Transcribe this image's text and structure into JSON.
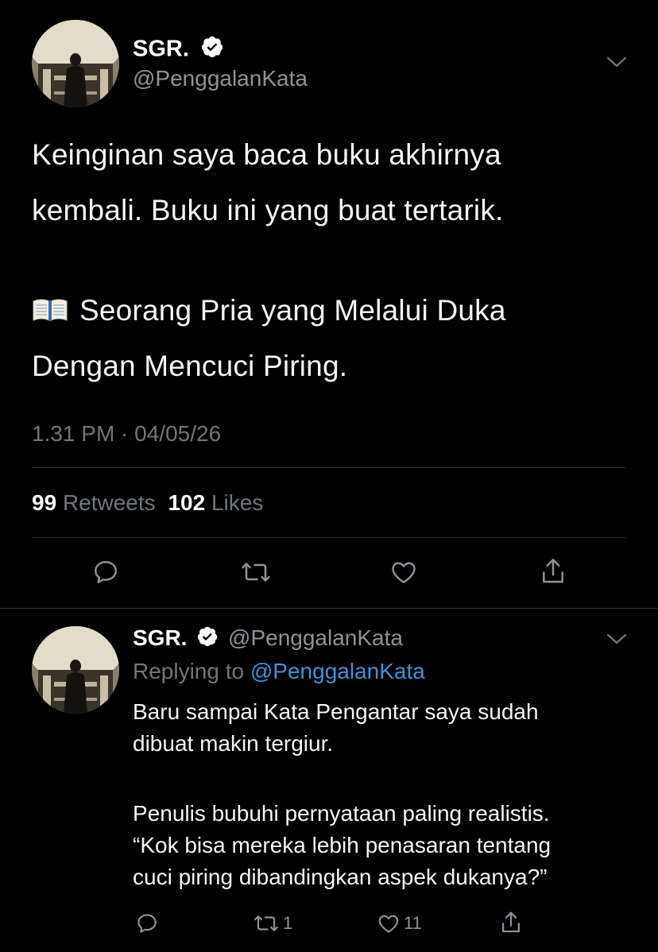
{
  "main_tweet": {
    "display_name": "SGR.",
    "handle": "@PenggalanKata",
    "text_line1": "Keinginan saya baca buku akhirnya",
    "text_line2": "kembali. Buku ini yang buat tertarik.",
    "book_line1": "Seorang Pria yang Melalui Duka",
    "book_line2": "Dengan Mencuci Piring.",
    "timestamp": "1.31 PM · 04/05/26",
    "retweets_count": "99",
    "retweets_label": "Retweets",
    "likes_count": "102",
    "likes_label": "Likes"
  },
  "reply_tweet": {
    "display_name": "SGR.",
    "handle": "@PenggalanKata",
    "replying_prefix": "Replying to",
    "replying_handle": "@PenggalanKata",
    "para1_line1": "Baru sampai Kata Pengantar saya sudah",
    "para1_line2": "dibuat makin tergiur.",
    "para2_line1": "Penulis bubuhi pernyataan paling realistis.",
    "para2_line2": "“Kok bisa mereka lebih penasaran tentang",
    "para2_line3": "cuci piring dibandingkan aspek dukanya?”",
    "retweet_count": "1",
    "like_count": "11"
  },
  "icons": {
    "verified": "verified-badge-icon",
    "more": "chevron-down-icon",
    "reply": "reply-icon",
    "retweet": "retweet-icon",
    "like": "heart-icon",
    "share": "share-icon",
    "book": "open-book-icon"
  },
  "colors": {
    "background": "#000000",
    "text": "#f5f5f5",
    "muted": "#71767b",
    "link": "#3b94d9",
    "divider": "#2f3336"
  }
}
